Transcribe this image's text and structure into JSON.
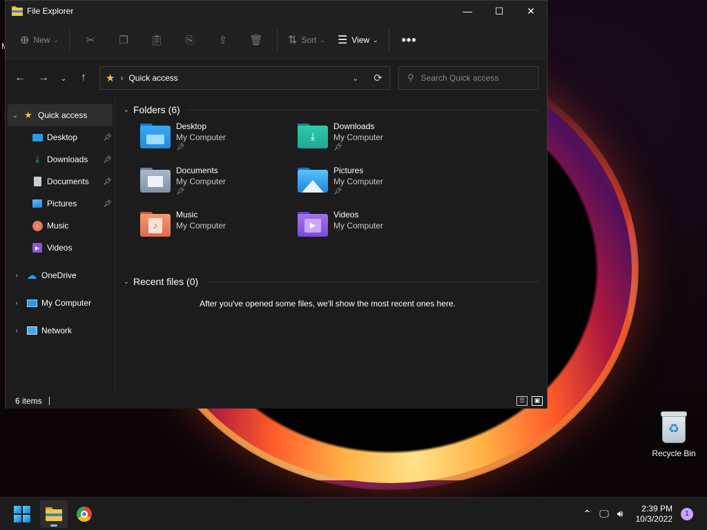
{
  "window": {
    "title": "File Explorer",
    "minimize_glyph": "—",
    "maximize_glyph": "☐",
    "close_glyph": "✕"
  },
  "toolbar": {
    "new_label": "New",
    "sort_label": "Sort",
    "view_label": "View",
    "more_glyph": "•••"
  },
  "address": {
    "location": "Quick access",
    "search_placeholder": "Search Quick access"
  },
  "nav": {
    "quick_access": "Quick access",
    "items": [
      {
        "label": "Desktop",
        "pinned": true
      },
      {
        "label": "Downloads",
        "pinned": true
      },
      {
        "label": "Documents",
        "pinned": true
      },
      {
        "label": "Pictures",
        "pinned": true
      },
      {
        "label": "Music",
        "pinned": false
      },
      {
        "label": "Videos",
        "pinned": false
      }
    ],
    "onedrive": "OneDrive",
    "my_computer": "My Computer",
    "network": "Network"
  },
  "folders": {
    "heading": "Folders (6)",
    "items": [
      {
        "name": "Desktop",
        "location": "My Computer",
        "pinned": true,
        "icon": "desktop-folder-icon",
        "color": "#1f8fe0"
      },
      {
        "name": "Downloads",
        "location": "My Computer",
        "pinned": true,
        "icon": "downloads-folder-icon",
        "color": "#1fb49a"
      },
      {
        "name": "Documents",
        "location": "My Computer",
        "pinned": true,
        "icon": "documents-folder-icon",
        "color": "#8aa0b8"
      },
      {
        "name": "Pictures",
        "location": "My Computer",
        "pinned": true,
        "icon": "pictures-folder-icon",
        "color": "#2a9be8"
      },
      {
        "name": "Music",
        "location": "My Computer",
        "pinned": false,
        "icon": "music-folder-icon",
        "color": "#e8785a"
      },
      {
        "name": "Videos",
        "location": "My Computer",
        "pinned": false,
        "icon": "videos-folder-icon",
        "color": "#8a55d8"
      }
    ]
  },
  "recent": {
    "heading": "Recent files (0)",
    "empty_message": "After you've opened some files, we'll show the most recent ones here."
  },
  "status": {
    "items_count": "6 items"
  },
  "desktop": {
    "recycle_bin_label": "Recycle Bin",
    "stray_text": "M"
  },
  "taskbar": {
    "time": "2:39 PM",
    "date": "10/3/2022",
    "notification_count": "1"
  }
}
